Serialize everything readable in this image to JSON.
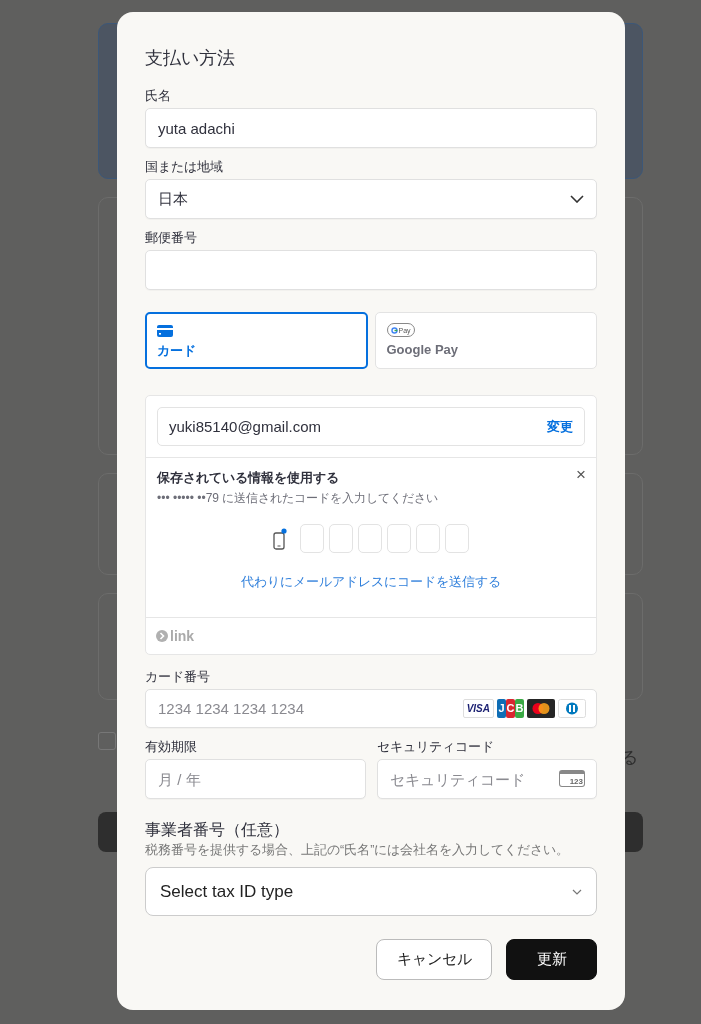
{
  "background": {
    "plan_cards": [
      {
        "selected": true
      },
      {
        "selected": false
      },
      {
        "selected": false
      },
      {
        "selected": false
      }
    ],
    "checkbox": {
      "checked": false
    },
    "side_text": "る"
  },
  "dialog": {
    "title": "支払い方法",
    "fields": [
      {
        "kind": "text",
        "label": "氏名",
        "value": "yuta adachi"
      },
      {
        "kind": "select",
        "label": "国または地域",
        "value": "日本"
      },
      {
        "kind": "text",
        "label": "郵便番号"
      }
    ],
    "payment_tabs": [
      {
        "kind": "card",
        "label": "カード",
        "selected": true
      },
      {
        "kind": "gpay",
        "label": "Google Pay",
        "badge": "Pay",
        "selected": false
      }
    ],
    "link": {
      "email": "yuki85140@gmail.com",
      "change": "変更",
      "saved_title": "保存されている情報を使用する",
      "close": "×",
      "subtitle": "••• ••••• ••79 に送信されたコードを入力してください",
      "code_boxes": [
        {
          "filled": false
        },
        {
          "filled": false
        },
        {
          "filled": false
        },
        {
          "filled": false
        },
        {
          "filled": false
        },
        {
          "filled": false
        }
      ],
      "alt_link": "代わりにメールアドレスにコードを送信する",
      "footer": "link"
    },
    "card_number": {
      "label": "カード番号",
      "placeholder": "1234 1234 1234 1234",
      "brands": [
        {
          "kind": "visa",
          "text": "VISA"
        },
        {
          "kind": "jcb",
          "text": "JCB"
        },
        {
          "kind": "mastercard"
        },
        {
          "kind": "diners"
        }
      ]
    },
    "expiry": {
      "label": "有効期限",
      "placeholder": "月 / 年"
    },
    "cvc": {
      "label": "セキュリティコード",
      "placeholder": "セキュリティコード",
      "icon_text": "123"
    },
    "tax": {
      "heading": "事業者番号（任意）",
      "hint": "税務番号を提供する場合、上記の“氏名”には会社名を入力してください。",
      "placeholder": "Select tax ID type"
    },
    "buttons": [
      {
        "kind": "secondary",
        "label": "キャンセル"
      },
      {
        "kind": "primary",
        "label": "更新"
      }
    ]
  }
}
